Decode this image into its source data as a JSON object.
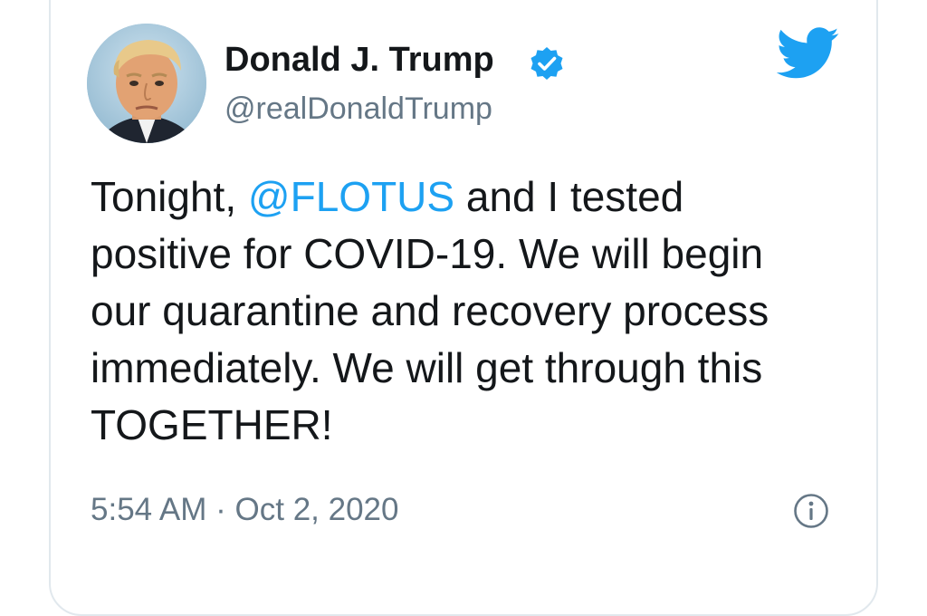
{
  "tweet": {
    "author_name": "Donald J. Trump",
    "handle": "@realDonaldTrump",
    "text_before": "Tonight, ",
    "mention": "@FLOTUS",
    "text_after": " and I tested positive for COVID-19. We will begin our quarantine and recovery process immediately. We will get through this TOGETHER!",
    "time": "5:54 AM",
    "separator": " · ",
    "date": "Oct 2, 2020",
    "verified": true
  },
  "icons": {
    "brand": "twitter-bird-icon",
    "verified": "verified-badge-icon",
    "info": "info-icon"
  },
  "colors": {
    "brand_blue": "#1da1f2",
    "text_primary": "#14171a",
    "text_secondary": "#657786",
    "border": "#e1e8ed"
  }
}
